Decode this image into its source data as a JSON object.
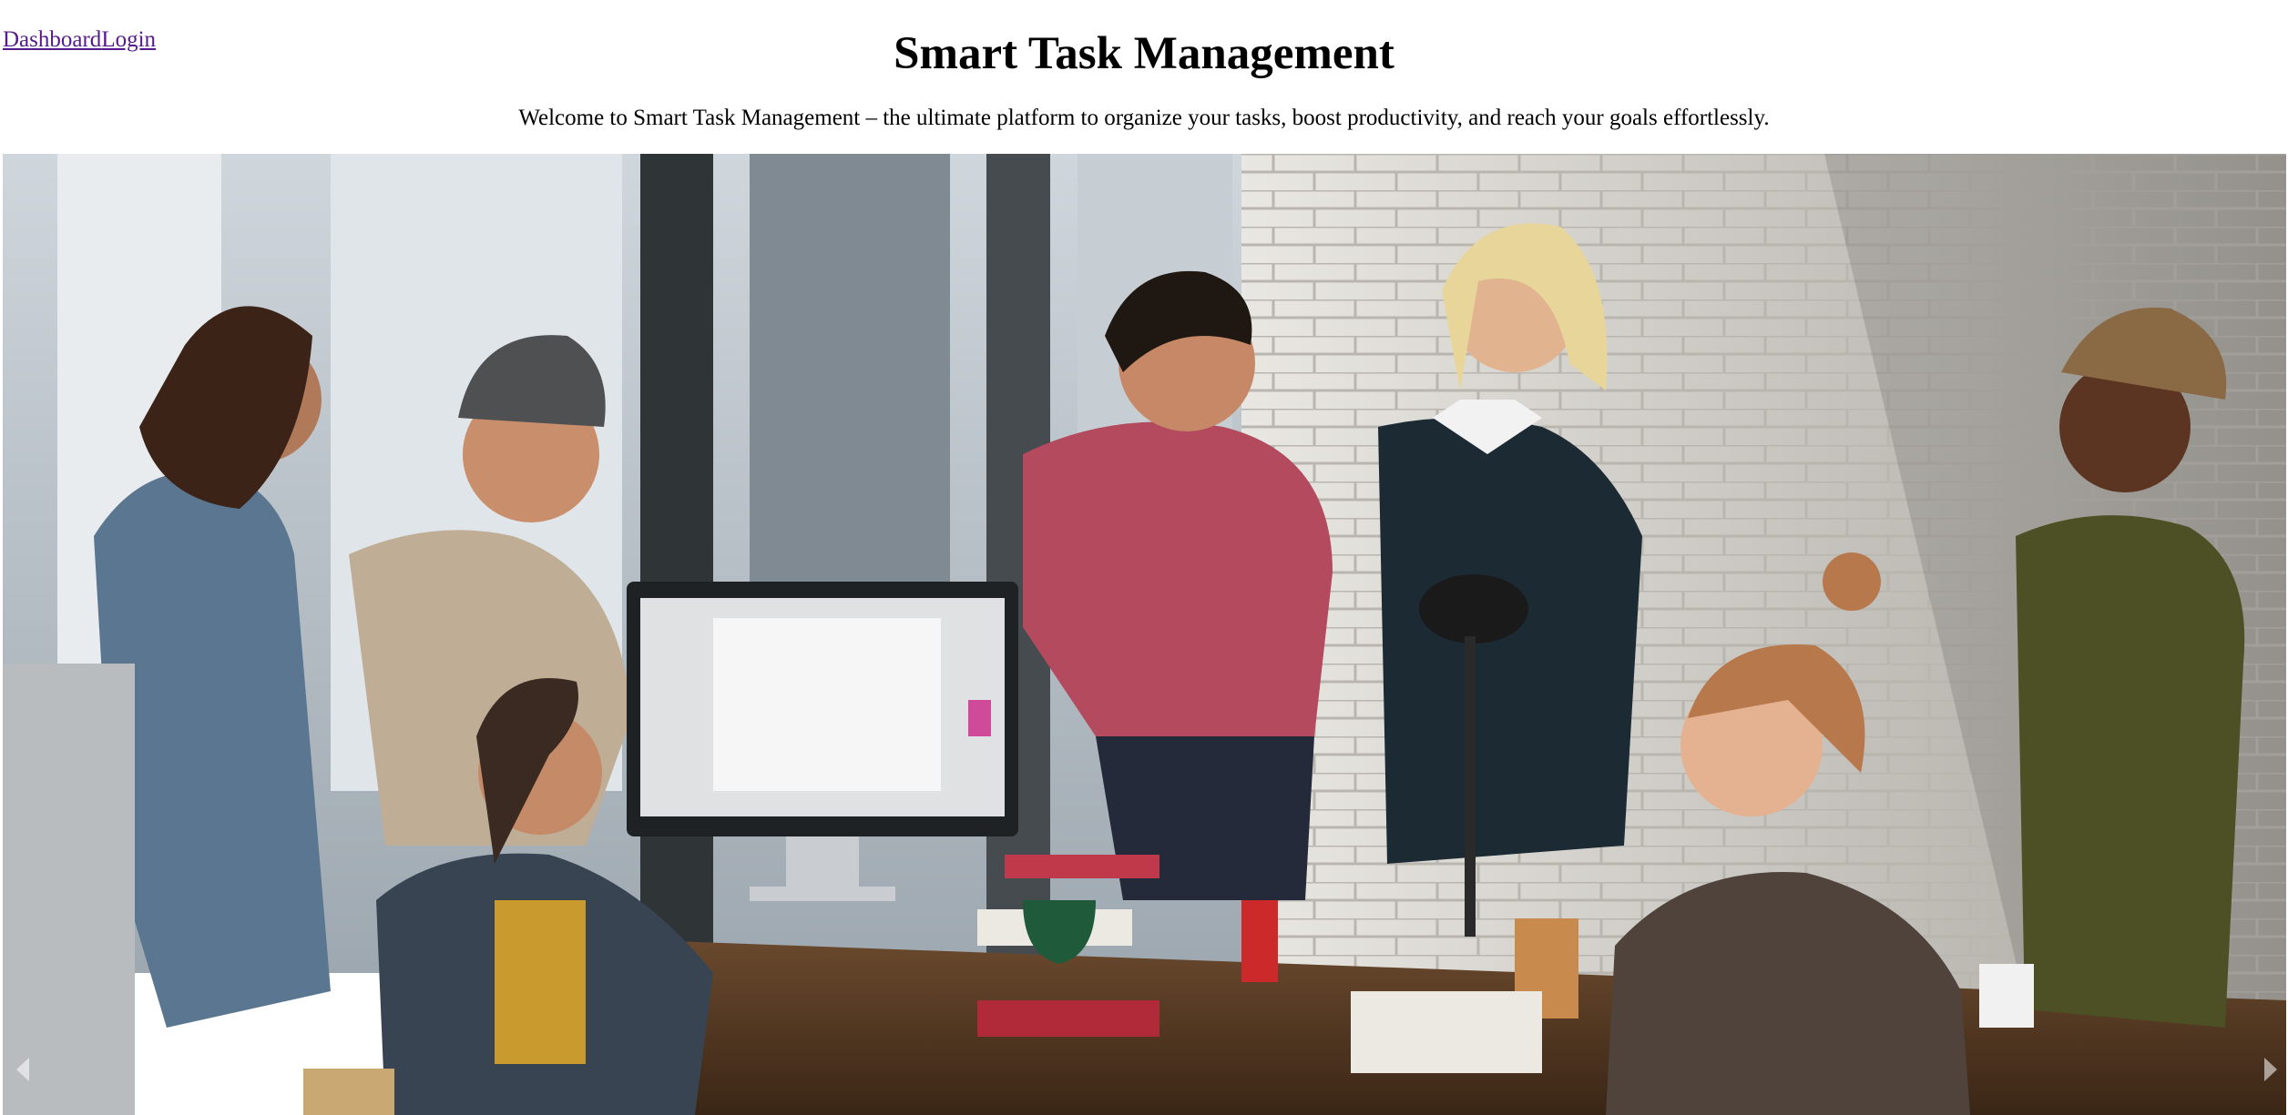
{
  "nav": {
    "links": [
      {
        "label": "Dashboard"
      },
      {
        "label": "Login"
      }
    ]
  },
  "hero": {
    "title": "Smart Task Management",
    "subtitle": "Welcome to Smart Task Management – the ultimate platform to organize your tasks, boost productivity, and reach your goals effortlessly."
  },
  "carousel": {
    "prev_icon": "chevron-left-icon",
    "next_icon": "chevron-right-icon"
  },
  "colors": {
    "link": "#551a8b",
    "text": "#000000",
    "background": "#ffffff"
  }
}
